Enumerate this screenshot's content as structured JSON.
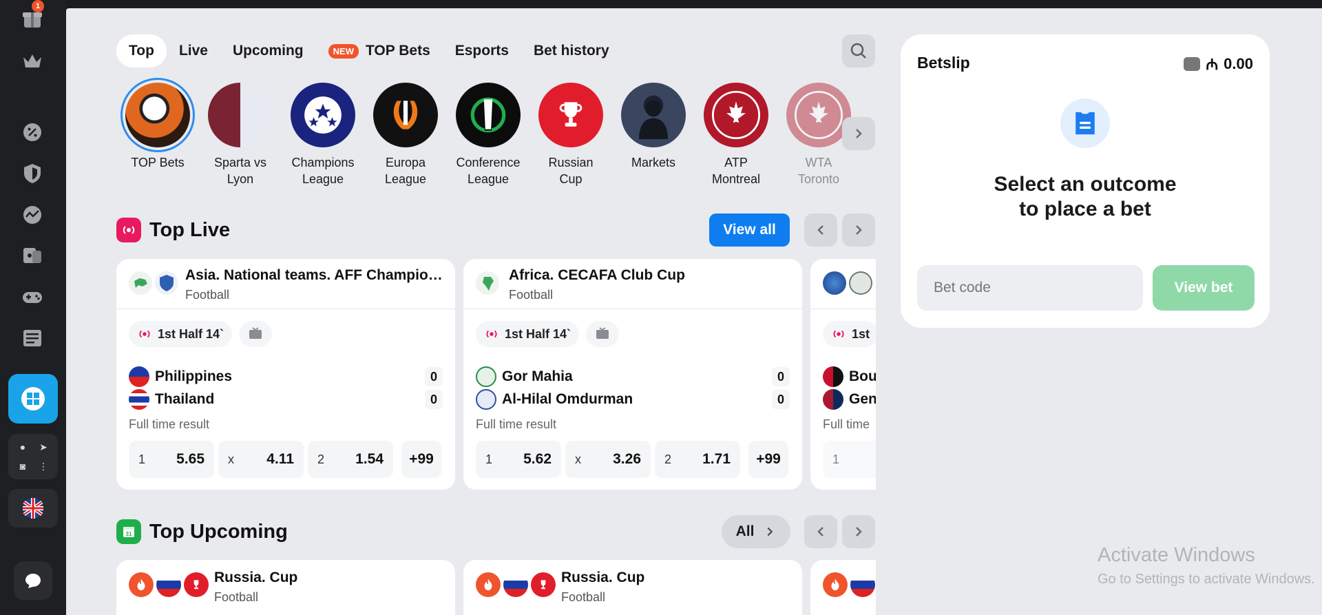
{
  "sidebar": {
    "gift_badge": "1",
    "social": [
      "whatsapp",
      "telegram",
      "instagram",
      "more"
    ]
  },
  "nav": {
    "tabs": [
      {
        "label": "Top",
        "active": true
      },
      {
        "label": "Live"
      },
      {
        "label": "Upcoming"
      },
      {
        "label": "TOP Bets",
        "badge": "NEW"
      },
      {
        "label": "Esports"
      },
      {
        "label": "Bet history"
      }
    ]
  },
  "stories": [
    {
      "label": "TOP Bets",
      "color": "#c94d1a"
    },
    {
      "label": "Sparta vs Lyon",
      "color": "#6b2c33"
    },
    {
      "label": "Champions League",
      "color": "#1a237e"
    },
    {
      "label": "Europa League",
      "color": "#111111"
    },
    {
      "label": "Conference League",
      "color": "#0c0c0c"
    },
    {
      "label": "Russian Cup",
      "color": "#e21d2b"
    },
    {
      "label": "Markets",
      "color": "#2a3142"
    },
    {
      "label": "ATP Montreal",
      "color": "#b11829"
    },
    {
      "label": "WTA Toronto",
      "color": "#b11829"
    }
  ],
  "top_live": {
    "title": "Top Live",
    "view_all": "View all",
    "cards": [
      {
        "league": "Asia. National teams. AFF Championship",
        "sport": "Football",
        "period": "1st Half 14`",
        "team1": "Philippines",
        "score1": "0",
        "team2": "Thailand",
        "score2": "0",
        "market": "Full time result",
        "odds": [
          {
            "k": "1",
            "v": "5.65"
          },
          {
            "k": "x",
            "v": "4.11"
          },
          {
            "k": "2",
            "v": "1.54"
          }
        ],
        "more": "+99"
      },
      {
        "league": "Africa. CECAFA Club Cup",
        "sport": "Football",
        "period": "1st Half 14`",
        "team1": "Gor Mahia",
        "score1": "0",
        "team2": "Al-Hilal Omdurman",
        "score2": "0",
        "market": "Full time result",
        "odds": [
          {
            "k": "1",
            "v": "5.62"
          },
          {
            "k": "x",
            "v": "3.26"
          },
          {
            "k": "2",
            "v": "1.71"
          }
        ],
        "more": "+99"
      },
      {
        "league": "",
        "sport": "",
        "period": "1st",
        "team1": "Bou",
        "score1": "",
        "team2": "Gen",
        "score2": "",
        "market": "Full time",
        "odds": [
          {
            "k": "1",
            "v": ""
          }
        ],
        "more": ""
      }
    ]
  },
  "top_upcoming": {
    "title": "Top Upcoming",
    "all": "All",
    "cards": [
      {
        "league": "Russia. Cup",
        "sport": "Football"
      },
      {
        "league": "Russia. Cup",
        "sport": "Football"
      }
    ]
  },
  "betslip": {
    "title": "Betslip",
    "balance": "0.00",
    "message_line1": "Select an outcome",
    "message_line2": "to place a bet",
    "code_placeholder": "Bet code",
    "view_bet": "View bet"
  },
  "watermark": {
    "line1": "Activate Windows",
    "line2": "Go to Settings to activate Windows."
  }
}
